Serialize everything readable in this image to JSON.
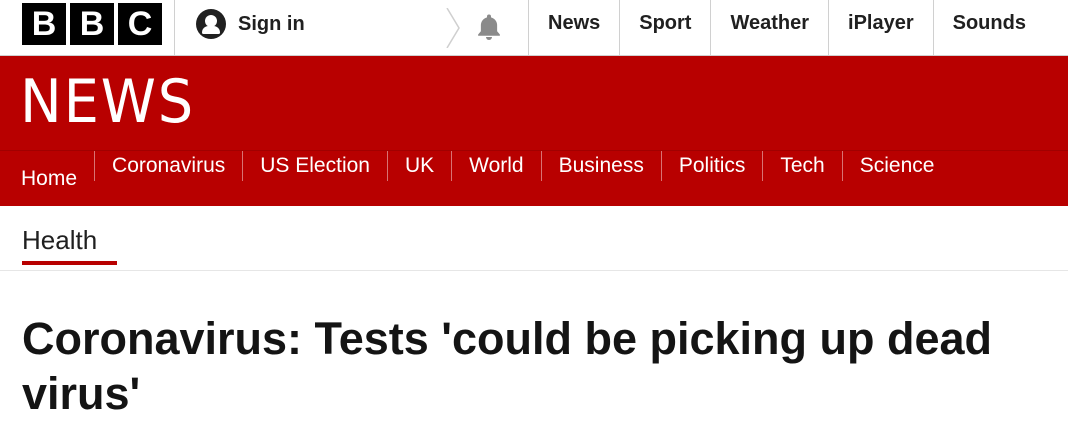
{
  "brand": {
    "letters": [
      "B",
      "B",
      "C"
    ]
  },
  "account": {
    "sign_in_label": "Sign in"
  },
  "top_nav": [
    "News",
    "Sport",
    "Weather",
    "iPlayer",
    "Sounds"
  ],
  "masthead": {
    "title": "NEWS",
    "color": "#b80000"
  },
  "section_nav": [
    "Home",
    "Coronavirus",
    "US Election",
    "UK",
    "World",
    "Business",
    "Politics",
    "Tech",
    "Science"
  ],
  "sub_nav": {
    "current": "Health"
  },
  "article": {
    "headline": "Coronavirus: Tests 'could be picking up dead virus'"
  },
  "icons": [
    "user-icon",
    "chevron-right-icon",
    "bell-icon"
  ]
}
